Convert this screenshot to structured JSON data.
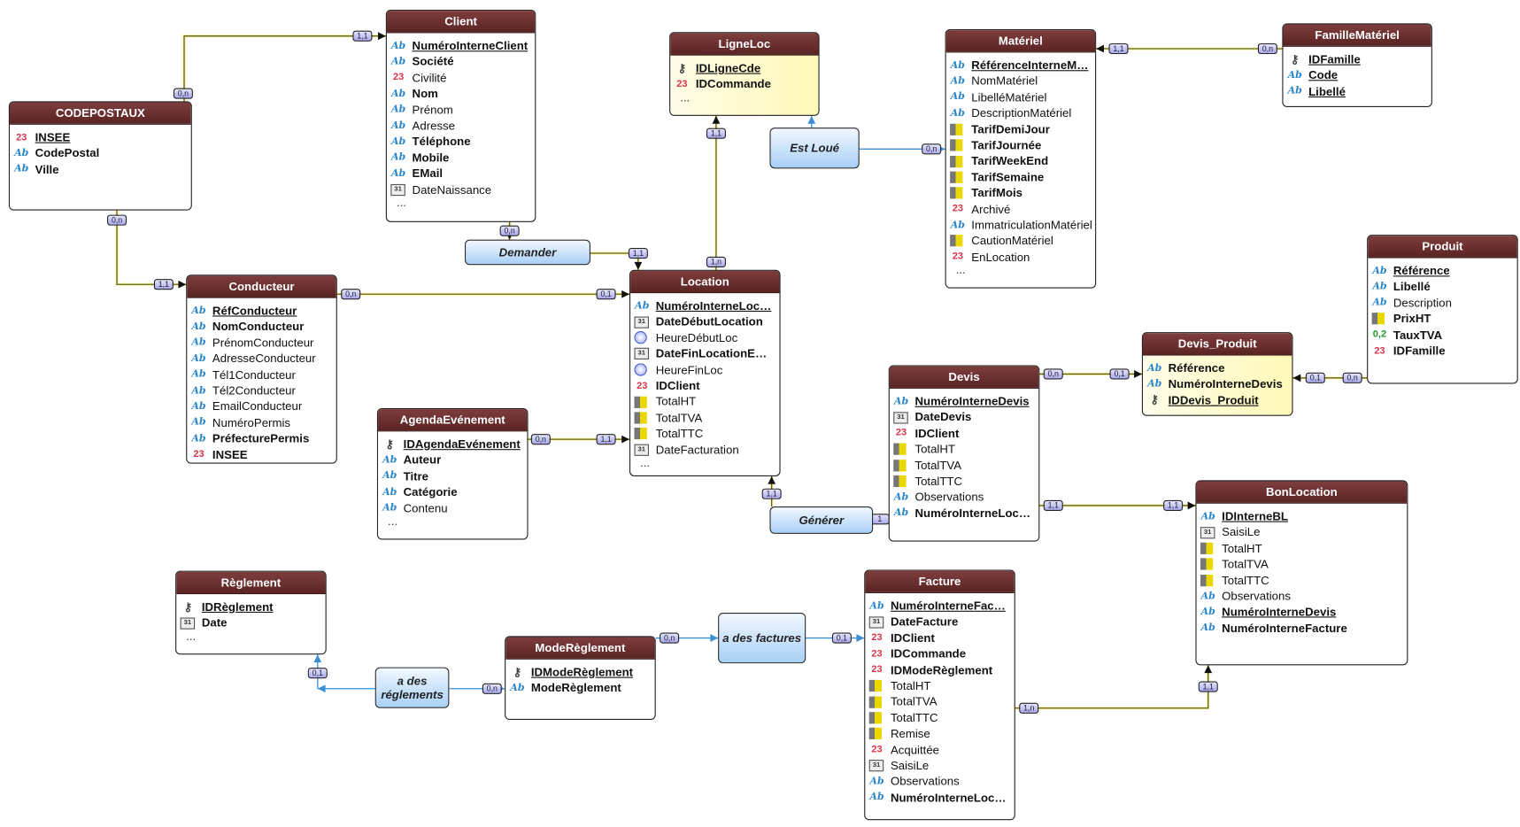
{
  "entities": [
    {
      "name": "CODEPOSTAUX",
      "fields": [
        {
          "name": "INSEE",
          "type": "int",
          "key": true,
          "required": true
        },
        {
          "name": "CodePostal",
          "type": "text",
          "required": true
        },
        {
          "name": "Ville",
          "type": "text",
          "required": true
        }
      ]
    },
    {
      "name": "Client",
      "more": "...",
      "fields": [
        {
          "name": "NuméroInterneClient",
          "type": "text",
          "key": true,
          "required": true
        },
        {
          "name": "Société",
          "type": "text",
          "required": true
        },
        {
          "name": "Civilité",
          "type": "int"
        },
        {
          "name": "Nom",
          "type": "text",
          "required": true
        },
        {
          "name": "Prénom",
          "type": "text"
        },
        {
          "name": "Adresse",
          "type": "text"
        },
        {
          "name": "Téléphone",
          "type": "text",
          "required": true
        },
        {
          "name": "Mobile",
          "type": "text",
          "required": true
        },
        {
          "name": "EMail",
          "type": "text",
          "required": true
        },
        {
          "name": "DateNaissance",
          "type": "date"
        }
      ]
    },
    {
      "name": "LigneLoc",
      "highlight": true,
      "more": "...",
      "fields": [
        {
          "name": "IDLigneCde",
          "type": "id",
          "key": true,
          "required": true
        },
        {
          "name": "IDCommande",
          "type": "int",
          "required": true
        }
      ]
    },
    {
      "name": "Matériel",
      "more": "...",
      "fields": [
        {
          "name": "RéférenceInterneM…",
          "type": "text",
          "key": true,
          "required": true
        },
        {
          "name": "NomMatériel",
          "type": "text"
        },
        {
          "name": "LibelléMatériel",
          "type": "text"
        },
        {
          "name": "DescriptionMatériel",
          "type": "text"
        },
        {
          "name": "TarifDemiJour",
          "type": "money",
          "required": true
        },
        {
          "name": "TarifJournée",
          "type": "money",
          "required": true
        },
        {
          "name": "TarifWeekEnd",
          "type": "money",
          "required": true
        },
        {
          "name": "TarifSemaine",
          "type": "money",
          "required": true
        },
        {
          "name": "TarifMois",
          "type": "money",
          "required": true
        },
        {
          "name": "Archivé",
          "type": "int"
        },
        {
          "name": "ImmatriculationMatériel",
          "type": "text"
        },
        {
          "name": "CautionMatériel",
          "type": "money"
        },
        {
          "name": "EnLocation",
          "type": "int"
        }
      ]
    },
    {
      "name": "FamilleMatériel",
      "fields": [
        {
          "name": "IDFamille",
          "type": "id",
          "key": true,
          "required": true
        },
        {
          "name": "Code",
          "type": "text",
          "key": true,
          "required": true
        },
        {
          "name": "Libellé",
          "type": "text",
          "key": true,
          "required": true
        }
      ]
    },
    {
      "name": "Produit",
      "fields": [
        {
          "name": "Référence",
          "type": "text",
          "key": true,
          "required": true
        },
        {
          "name": "Libellé",
          "type": "text",
          "required": true
        },
        {
          "name": "Description",
          "type": "text"
        },
        {
          "name": "PrixHT",
          "type": "money",
          "required": true
        },
        {
          "name": "TauxTVA",
          "type": "real",
          "required": true
        },
        {
          "name": "IDFamille",
          "type": "int",
          "required": true
        }
      ]
    },
    {
      "name": "Conducteur",
      "fields": [
        {
          "name": "RéfConducteur",
          "type": "text",
          "key": true,
          "required": true
        },
        {
          "name": "NomConducteur",
          "type": "text",
          "required": true
        },
        {
          "name": "PrénomConducteur",
          "type": "text"
        },
        {
          "name": "AdresseConducteur",
          "type": "text"
        },
        {
          "name": "Tél1Conducteur",
          "type": "text"
        },
        {
          "name": "Tél2Conducteur",
          "type": "text"
        },
        {
          "name": "EmailConducteur",
          "type": "text"
        },
        {
          "name": "NuméroPermis",
          "type": "text"
        },
        {
          "name": "PréfecturePermis",
          "type": "text",
          "required": true
        },
        {
          "name": "INSEE",
          "type": "int",
          "required": true
        }
      ]
    },
    {
      "name": "Location",
      "more": "...",
      "fields": [
        {
          "name": "NuméroInterneLoc…",
          "type": "text",
          "key": true,
          "required": true
        },
        {
          "name": "DateDébutLocation",
          "type": "date",
          "required": true
        },
        {
          "name": "HeureDébutLoc",
          "type": "time"
        },
        {
          "name": "DateFinLocationE…",
          "type": "date",
          "required": true
        },
        {
          "name": "HeureFinLoc",
          "type": "time"
        },
        {
          "name": "IDClient",
          "type": "int",
          "required": true
        },
        {
          "name": "TotalHT",
          "type": "money"
        },
        {
          "name": "TotalTVA",
          "type": "money"
        },
        {
          "name": "TotalTTC",
          "type": "money"
        },
        {
          "name": "DateFacturation",
          "type": "date"
        }
      ]
    },
    {
      "name": "AgendaEvénement",
      "more": "...",
      "fields": [
        {
          "name": "IDAgendaEvénement",
          "type": "id",
          "key": true,
          "required": true
        },
        {
          "name": "Auteur",
          "type": "text",
          "required": true
        },
        {
          "name": "Titre",
          "type": "text",
          "required": true
        },
        {
          "name": "Catégorie",
          "type": "text",
          "required": true
        },
        {
          "name": "Contenu",
          "type": "text"
        }
      ]
    },
    {
      "name": "Devis",
      "fields": [
        {
          "name": "NuméroInterneDevis",
          "type": "text",
          "key": true,
          "required": true
        },
        {
          "name": "DateDevis",
          "type": "date",
          "required": true
        },
        {
          "name": "IDClient",
          "type": "int",
          "required": true
        },
        {
          "name": "TotalHT",
          "type": "money"
        },
        {
          "name": "TotalTVA",
          "type": "money"
        },
        {
          "name": "TotalTTC",
          "type": "money"
        },
        {
          "name": "Observations",
          "type": "text"
        },
        {
          "name": "NuméroInterneLoc…",
          "type": "text",
          "required": true
        }
      ]
    },
    {
      "name": "Devis_Produit",
      "highlight": true,
      "fields": [
        {
          "name": "Référence",
          "type": "text",
          "required": true
        },
        {
          "name": "NuméroInterneDevis",
          "type": "text",
          "required": true
        },
        {
          "name": "IDDevis_Produit",
          "type": "idplus",
          "key": true,
          "required": true
        }
      ]
    },
    {
      "name": "BonLocation",
      "fields": [
        {
          "name": "IDInterneBL",
          "type": "text",
          "key": true,
          "required": true
        },
        {
          "name": "SaisiLe",
          "type": "date"
        },
        {
          "name": "TotalHT",
          "type": "money"
        },
        {
          "name": "TotalTVA",
          "type": "money"
        },
        {
          "name": "TotalTTC",
          "type": "money"
        },
        {
          "name": "Observations",
          "type": "text"
        },
        {
          "name": "NuméroInterneDevis",
          "type": "text",
          "key": true,
          "required": true
        },
        {
          "name": "NuméroInterneFacture",
          "type": "text",
          "required": true
        }
      ]
    },
    {
      "name": "Règlement",
      "more": "...",
      "fields": [
        {
          "name": "IDRèglement",
          "type": "id",
          "key": true,
          "required": true
        },
        {
          "name": "Date",
          "type": "date",
          "required": true
        }
      ]
    },
    {
      "name": "ModeRèglement",
      "fields": [
        {
          "name": "IDModeRèglement",
          "type": "id",
          "key": true,
          "required": true
        },
        {
          "name": "ModeRèglement",
          "type": "text",
          "required": true
        }
      ]
    },
    {
      "name": "Facture",
      "fields": [
        {
          "name": "NuméroInterneFac…",
          "type": "text",
          "key": true,
          "required": true
        },
        {
          "name": "DateFacture",
          "type": "date",
          "required": true
        },
        {
          "name": "IDClient",
          "type": "int",
          "required": true
        },
        {
          "name": "IDCommande",
          "type": "int",
          "required": true
        },
        {
          "name": "IDModeRèglement",
          "type": "int",
          "required": true
        },
        {
          "name": "TotalHT",
          "type": "money"
        },
        {
          "name": "TotalTVA",
          "type": "money"
        },
        {
          "name": "TotalTTC",
          "type": "money"
        },
        {
          "name": "Remise",
          "type": "money"
        },
        {
          "name": "Acquittée",
          "type": "int"
        },
        {
          "name": "SaisiLe",
          "type": "date"
        },
        {
          "name": "Observations",
          "type": "text"
        },
        {
          "name": "NuméroInterneLoc…",
          "type": "text",
          "required": true
        }
      ]
    }
  ],
  "relations": [
    {
      "label": "Demander"
    },
    {
      "label": "Est Loué"
    },
    {
      "label": "Générer"
    },
    {
      "label": "a des factures"
    },
    {
      "label": "a des réglements"
    }
  ],
  "cardinalities": [
    "0,n",
    "1,1",
    "0,n",
    "1,1",
    "0,n",
    "1,1",
    "0,n",
    "0,1",
    "1,n",
    "1,1",
    "0,n",
    "0,n",
    "1,1",
    "0,n",
    "1,1",
    "1,1",
    "1",
    "0,n",
    "0,1",
    "0,n",
    "0,1",
    "1,1",
    "1,1",
    "1,n",
    "1,1",
    "0,n",
    "0,1",
    "0,1",
    "0,n"
  ],
  "icons": {
    "text": "Ab",
    "int": "23",
    "real": "0,2",
    "date": "31",
    "time": "",
    "money": "",
    "id": "⚷",
    "idplus": "⚷"
  },
  "colors": {
    "header": "#6b2e2e",
    "relation": "#a8d0f6",
    "link": "#5e5e1e",
    "link_blue": "#3b8fd6",
    "cardinality": "#b8b8f4"
  }
}
